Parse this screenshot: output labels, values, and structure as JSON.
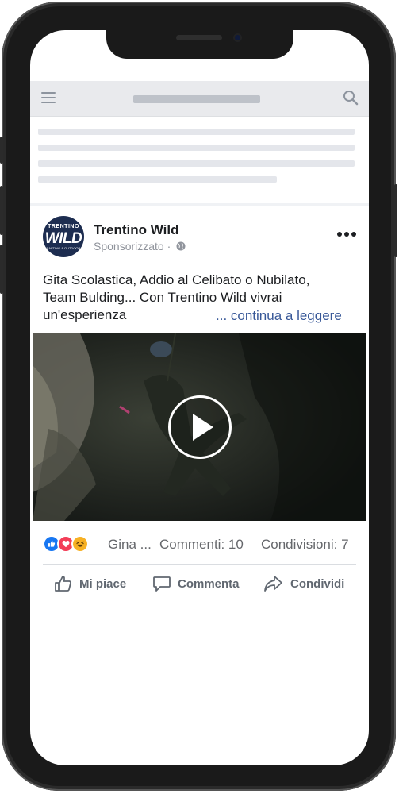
{
  "topbar": {
    "menu_icon": "hamburger-menu-icon",
    "search_icon": "search-icon"
  },
  "post": {
    "page_name": "Trentino Wild",
    "sponsored": "Sponsorizzato ·",
    "avatar": {
      "top": "TRENTINO",
      "main": "WILD",
      "sub": "RAFTING & OUTDOOR"
    },
    "text_line1": "Gita Scolastica, Addio al Celibato o Nubilato,",
    "text_line2": "Team Bulding... Con Trentino Wild vivrai",
    "text_line3": "un'esperienza",
    "continue": "... continua a leggere",
    "reactions_names": "Gina ...",
    "comments": "Commenti: 10",
    "shares": "Condivisioni: 7"
  },
  "actions": {
    "like": "Mi piace",
    "comment": "Commenta",
    "share": "Condividi"
  },
  "colors": {
    "brand_blue": "#1877f2",
    "link": "#385898",
    "avatar_bg": "#1d2d50"
  }
}
